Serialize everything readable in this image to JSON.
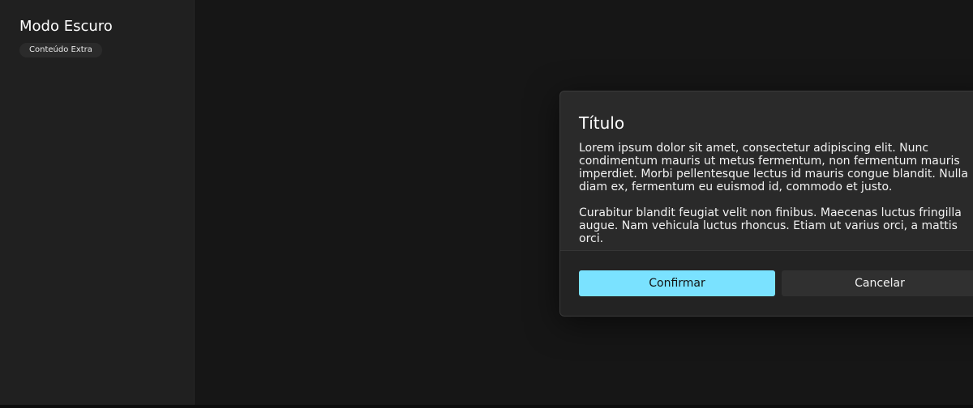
{
  "sidebar": {
    "title": "Modo Escuro",
    "badge": "Conteúdo Extra"
  },
  "modal": {
    "title": "Título",
    "paragraphs": [
      "Lorem ipsum dolor sit amet, consectetur adipiscing elit. Nunc condimentum mauris ut metus fermentum, non fermentum mauris imperdiet. Morbi pellentesque lectus id mauris congue blandit. Nulla diam ex, fermentum eu euismod id, commodo et justo.",
      "Curabitur blandit feugiat velit non finibus. Maecenas luctus fringilla augue. Nam vehicula luctus rhoncus. Etiam ut varius orci, a mattis orci."
    ],
    "confirm_label": "Confirmar",
    "cancel_label": "Cancelar"
  },
  "colors": {
    "accent": "#7ae2ff",
    "sidebar_bg": "#202020",
    "modal_bg": "#2a2a2a"
  }
}
